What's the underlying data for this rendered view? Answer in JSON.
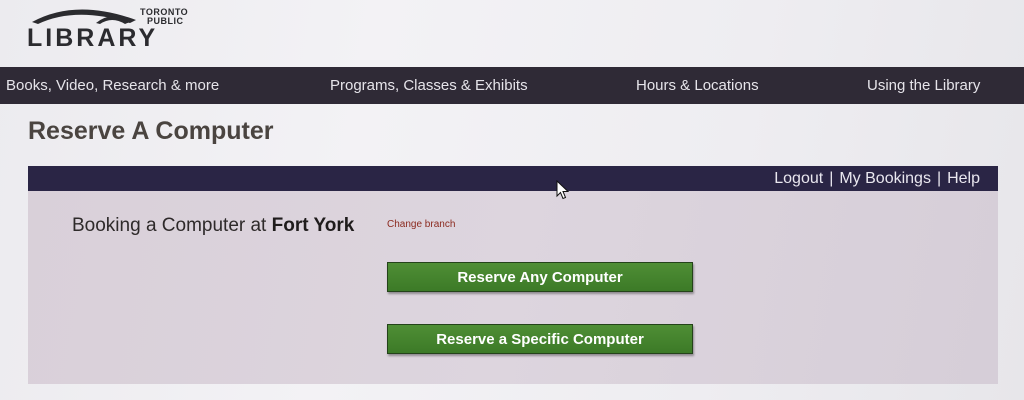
{
  "logo": {
    "line1": "TORONTO",
    "line2": "PUBLIC",
    "line3": "LIBRARY"
  },
  "nav": {
    "items": [
      {
        "label": "Books, Video, Research & more"
      },
      {
        "label": "Programs, Classes & Exhibits"
      },
      {
        "label": "Hours & Locations"
      },
      {
        "label": "Using the Library"
      }
    ]
  },
  "page": {
    "title": "Reserve A Computer"
  },
  "panel": {
    "links": {
      "logout": "Logout",
      "my_bookings": "My Bookings",
      "help": "Help",
      "separator": "|"
    },
    "booking_prefix": "Booking a Computer at",
    "branch": "Fort York",
    "change_branch": "Change branch",
    "buttons": {
      "any": "Reserve Any Computer",
      "specific": "Reserve a Specific Computer"
    }
  },
  "colors": {
    "navbar": "#2f2a36",
    "panel_bar": "#2a2545",
    "button_green": "#4a8a31",
    "change_branch_red": "#8b2a1f"
  },
  "icons": {
    "logo_mark": "library-roof-logo-icon",
    "pointer": "mouse-cursor-icon"
  }
}
